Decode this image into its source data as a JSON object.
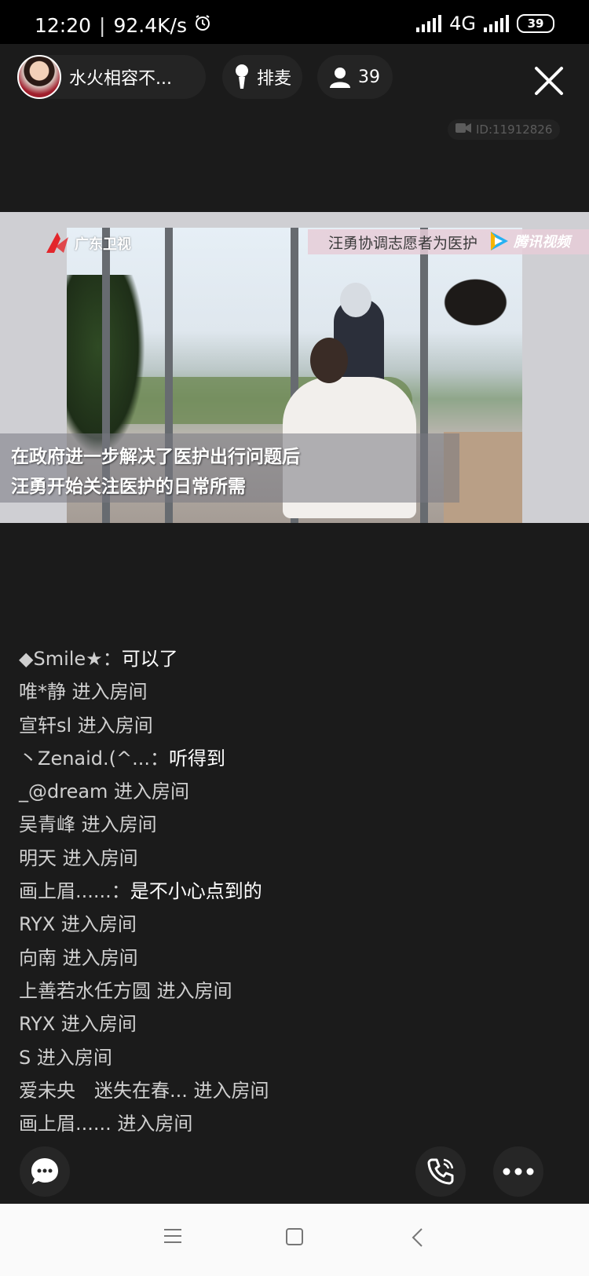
{
  "status_bar": {
    "time": "12:20",
    "separator": "|",
    "net_speed": "92.4K/s",
    "network": "4G",
    "battery": "39"
  },
  "room": {
    "host_name": "水火相容不...",
    "queue_label": "排麦",
    "online_count": "39",
    "room_id": "ID:11912826"
  },
  "video": {
    "channel_logo": "广东卫视",
    "banner_text": "汪勇协调志愿者为医护",
    "platform_logo": "腾讯视频",
    "subtitle_line1": "在政府进一步解决了医护出行问题后",
    "subtitle_line2": "汪勇开始关注医护的日常所需"
  },
  "chat": [
    {
      "user": "◆Smile★：",
      "text": "可以了"
    },
    {
      "user": "唯*静 进入房间",
      "text": ""
    },
    {
      "user": "宣轩sl 进入房间",
      "text": ""
    },
    {
      "user": "丶Zenaid.(^...：",
      "text": "听得到"
    },
    {
      "user": "_@dream 进入房间",
      "text": ""
    },
    {
      "user": "吴青峰 进入房间",
      "text": ""
    },
    {
      "user": "明天 进入房间",
      "text": ""
    },
    {
      "user": "画上眉......：",
      "text": "是不小心点到的"
    },
    {
      "user": "RYX 进入房间",
      "text": ""
    },
    {
      "user": "向南 进入房间",
      "text": ""
    },
    {
      "user": "上善若水任方圆 进入房间",
      "text": ""
    },
    {
      "user": "RYX 进入房间",
      "text": ""
    },
    {
      "user": "S 进入房间",
      "text": ""
    },
    {
      "user": "爱未央　迷失在春... 进入房间",
      "text": ""
    },
    {
      "user": "画上眉...... 进入房间",
      "text": ""
    }
  ],
  "icons": {
    "alarm": "alarm-clock-icon",
    "signal": "signal-icon",
    "battery": "battery-icon",
    "mic": "microphone-icon",
    "user": "user-icon",
    "close": "close-icon",
    "camera": "video-camera-icon",
    "chat": "chat-bubble-icon",
    "call": "phone-call-icon",
    "more": "more-dots-icon",
    "nav_menu": "menu-icon",
    "nav_home": "home-square-icon",
    "nav_back": "back-chevron-icon"
  },
  "colors": {
    "background": "#1b1b1b",
    "pill": "#242424",
    "chat_user": "#cfcfcf",
    "chat_text": "#ffffff",
    "navbar": "#fafafa"
  }
}
